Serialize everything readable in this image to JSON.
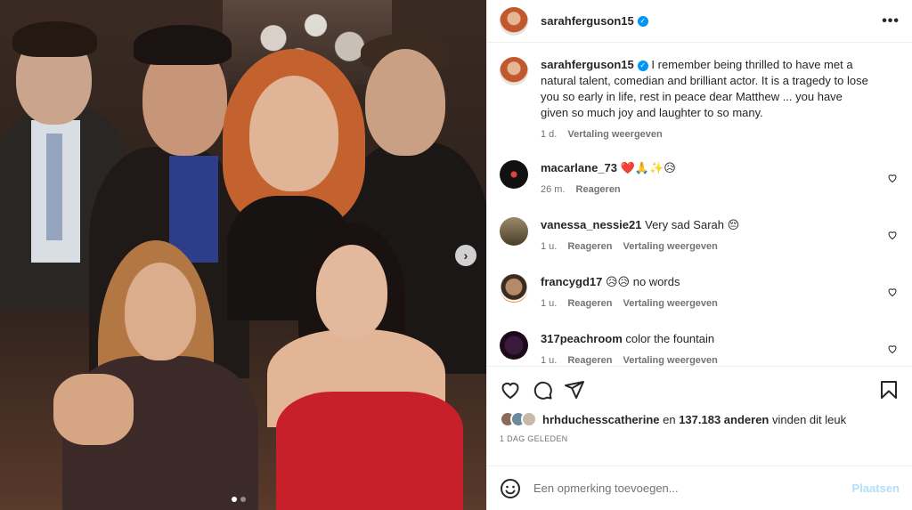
{
  "post": {
    "username": "sarahferguson15",
    "caption": "I remember being thrilled to have met a natural talent, comedian and brilliant actor. It is a tragedy to lose you so early in life, rest in peace dear Matthew ... you have given so much joy and laughter to so many.",
    "caption_time": "1 d.",
    "caption_translate": "Vertaling weergeven",
    "more_label": "•••",
    "next_label": "›"
  },
  "comments": [
    {
      "username": "macarlane_73",
      "text": "❤️🙏✨😥",
      "time": "26 m.",
      "reply": "Reageren",
      "translate": ""
    },
    {
      "username": "vanessa_nessie21",
      "text": "Very sad Sarah 😔",
      "time": "1 u.",
      "reply": "Reageren",
      "translate": "Vertaling weergeven"
    },
    {
      "username": "francygd17",
      "text": "😥😥 no words",
      "time": "1 u.",
      "reply": "Reageren",
      "translate": "Vertaling weergeven"
    },
    {
      "username": "317peachroom",
      "text": "color the fountain",
      "time": "1 u.",
      "reply": "Reageren",
      "translate": "Vertaling weergeven"
    }
  ],
  "likes": {
    "liker": "hrhduchesscatherine",
    "connector": " en ",
    "count": "137.183 anderen",
    "suffix": " vinden dit leuk"
  },
  "posted_ago": "1 DAG GELEDEN",
  "add_comment": {
    "placeholder": "Een opmerking toevoegen...",
    "post_label": "Plaatsen",
    "emoji_icon": "smiley-icon"
  },
  "icons": [
    "heart-icon",
    "comment-icon",
    "share-icon",
    "bookmark-icon"
  ],
  "colors": {
    "verified": "#0095f6",
    "post_disabled": "#b2dffc",
    "secondary_text": "#737373"
  },
  "carousel": {
    "total": 2,
    "active": 0
  }
}
